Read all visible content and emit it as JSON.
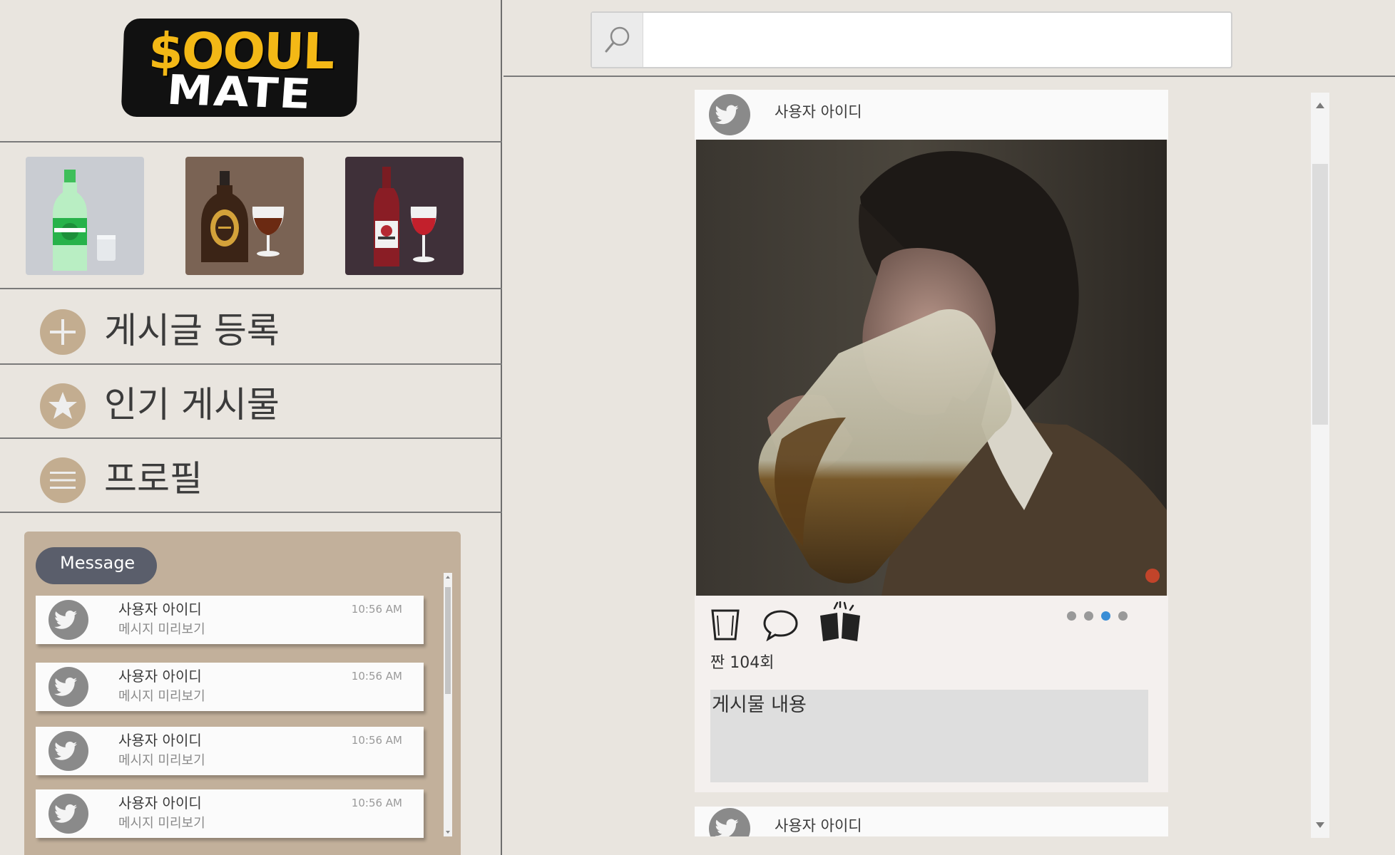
{
  "app": {
    "logo_top": "$OOUL",
    "logo_bottom": "MATE"
  },
  "drinks": [
    {
      "name": "soju",
      "bg": "#c9ccd2"
    },
    {
      "name": "whiskey",
      "bg": "#7a6354"
    },
    {
      "name": "wine",
      "bg": "#3f3039"
    }
  ],
  "menu": [
    {
      "icon": "plus-icon",
      "label": "게시글 등록"
    },
    {
      "icon": "star-icon",
      "label": "인기 게시물"
    },
    {
      "icon": "hamburger-icon",
      "label": "프로필"
    }
  ],
  "messages": {
    "tab_label": "Message",
    "items": [
      {
        "user": "사용자 아이디",
        "preview": "메시지 미리보기",
        "time": "10:56 AM"
      },
      {
        "user": "사용자 아이디",
        "preview": "메시지 미리보기",
        "time": "10:56 AM"
      },
      {
        "user": "사용자 아이디",
        "preview": "메시지 미리보기",
        "time": "10:56 AM"
      },
      {
        "user": "사용자 아이디",
        "preview": "메시지 미리보기",
        "time": "10:56 AM"
      }
    ]
  },
  "search": {
    "icon": "search-icon",
    "value": "",
    "placeholder": ""
  },
  "feed": {
    "posts": [
      {
        "user": "사용자 아이디",
        "cheers_text": "짠 104회",
        "content": "게시물 내용",
        "carousel_total": 4,
        "carousel_active": 3
      },
      {
        "user": "사용자 아이디"
      }
    ]
  },
  "colors": {
    "background": "#e9e5df",
    "accent_tan": "#c3ad90",
    "message_panel": "#c2b09b",
    "message_tab": "#5a5e6b",
    "logo_yellow": "#f3b816",
    "carousel_active": "#3a8ed6"
  }
}
